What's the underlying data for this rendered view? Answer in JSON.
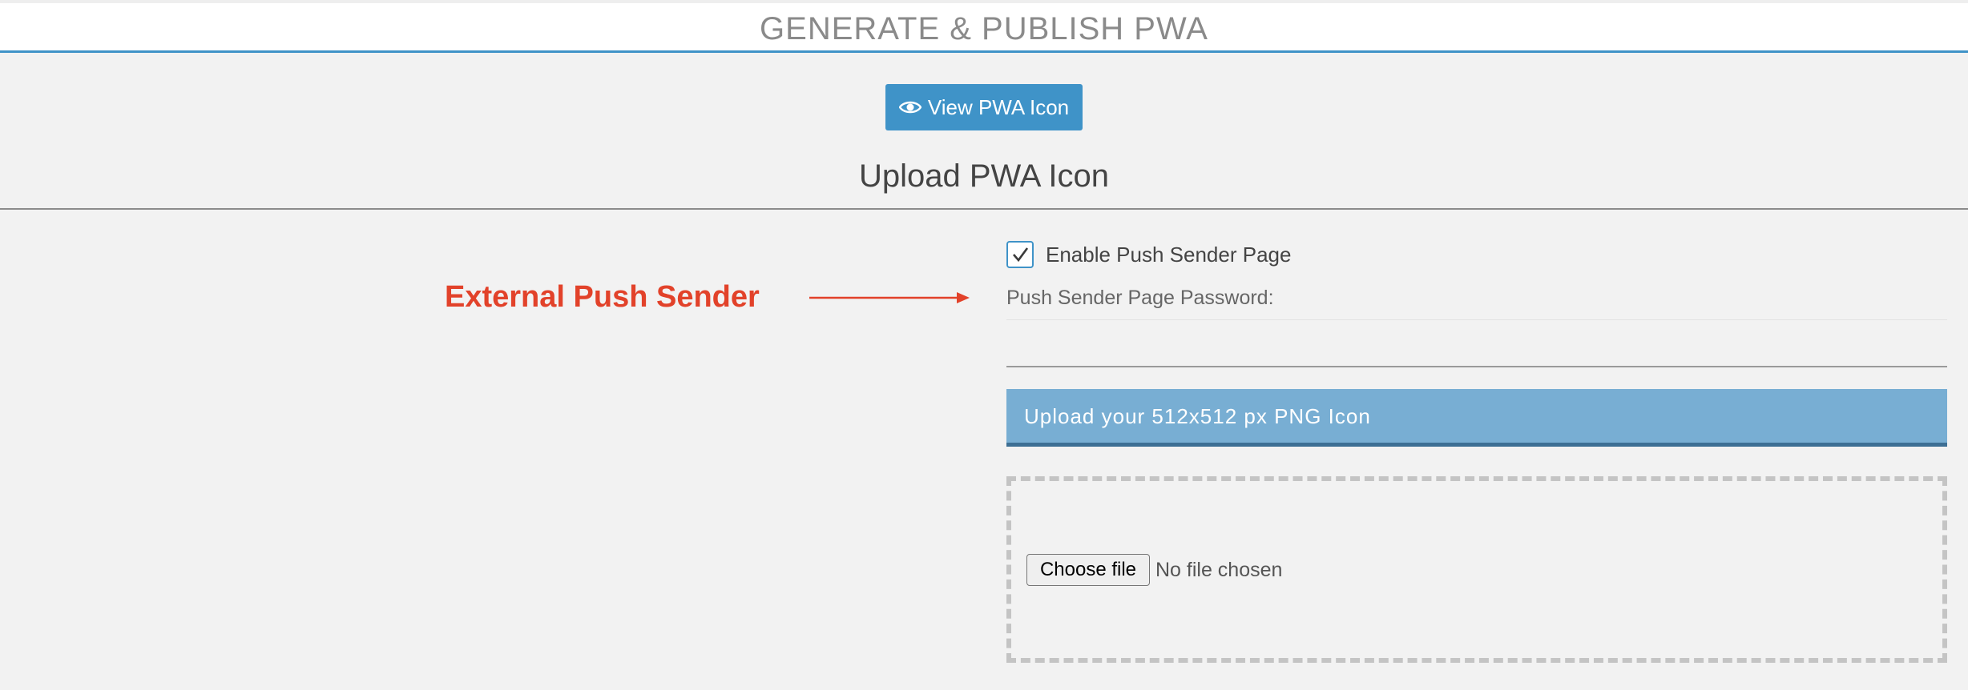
{
  "header": {
    "title": "GENERATE & PUBLISH PWA",
    "accent_color": "#3f93c8"
  },
  "toolbar": {
    "view_icon_label": "View PWA Icon",
    "view_icon_glyph": "eye-icon"
  },
  "section": {
    "title": "Upload PWA Icon"
  },
  "annotation": {
    "text": "External Push Sender",
    "color": "#e2422a"
  },
  "push_sender": {
    "enable_label": "Enable Push Sender Page",
    "enabled": true,
    "password_label": "Push Sender Page Password:",
    "password_value": ""
  },
  "upload": {
    "banner_text": "Upload your 512x512 px PNG Icon",
    "choose_file_label": "Choose file",
    "file_status": "No file chosen"
  }
}
